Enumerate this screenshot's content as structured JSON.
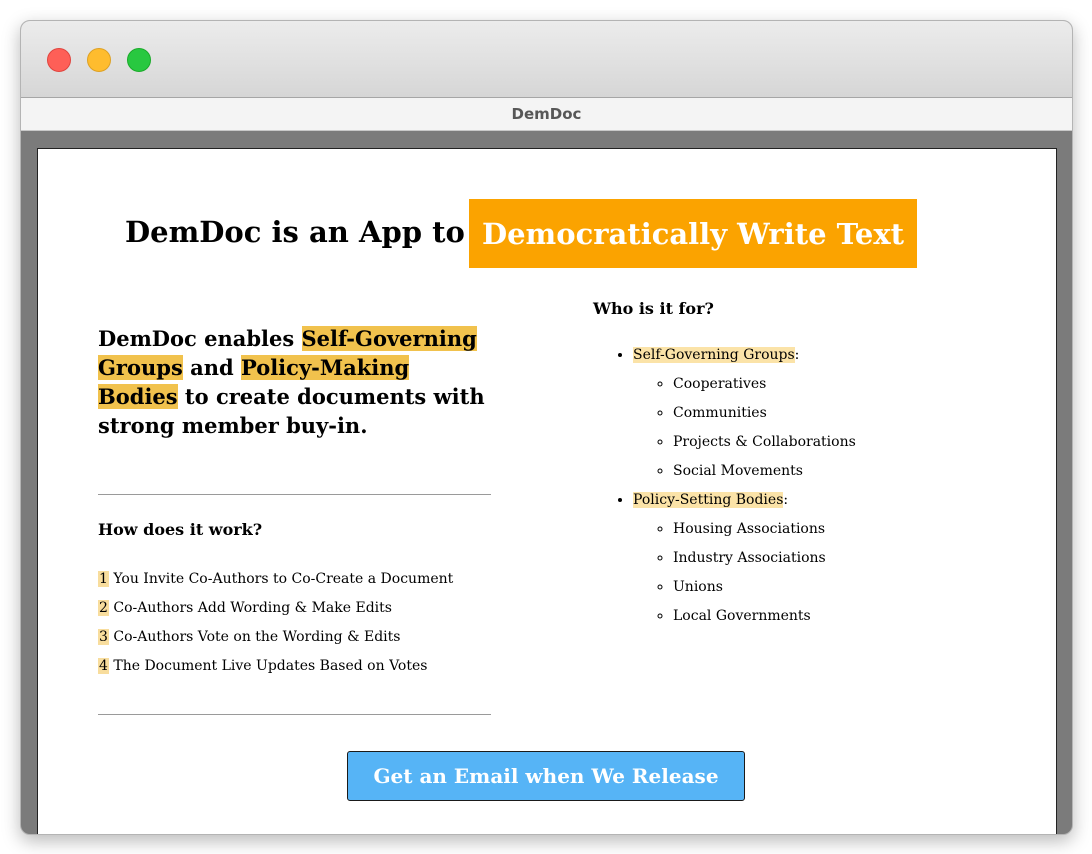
{
  "window": {
    "title": "DemDoc"
  },
  "hero": {
    "text": "DemDoc is an App to",
    "highlight": "Democratically Write Text"
  },
  "tagline": {
    "p1": "DemDoc enables ",
    "h1": "Self-Governing Groups",
    "p2": " and ",
    "h2": "Policy-Making Bodies",
    "p3": " to create documents with strong member buy-in."
  },
  "how": {
    "heading": "How does it work?",
    "steps": [
      {
        "num": "1",
        "text": " You Invite Co-Authors to Co-Create a Document"
      },
      {
        "num": "2",
        "text": " Co-Authors Add Wording & Make Edits"
      },
      {
        "num": "3",
        "text": " Co-Authors Vote on the Wording & Edits"
      },
      {
        "num": "4",
        "text": " The Document Live Updates Based on Votes"
      }
    ]
  },
  "who": {
    "heading": "Who is it for?",
    "groups": [
      {
        "label": "Self-Governing Groups",
        "items": [
          "Cooperatives",
          "Communities",
          "Projects & Collaborations",
          "Social Movements"
        ]
      },
      {
        "label": "Policy-Setting Bodies",
        "items": [
          "Housing Associations",
          "Industry Associations",
          "Unions",
          "Local Governments"
        ]
      }
    ]
  },
  "cta": {
    "label": "Get an Email when We Release"
  },
  "colors": {
    "accent_orange": "#fba300",
    "highlight_yellow": "#f1c24d",
    "button_blue": "#56b4f6"
  }
}
